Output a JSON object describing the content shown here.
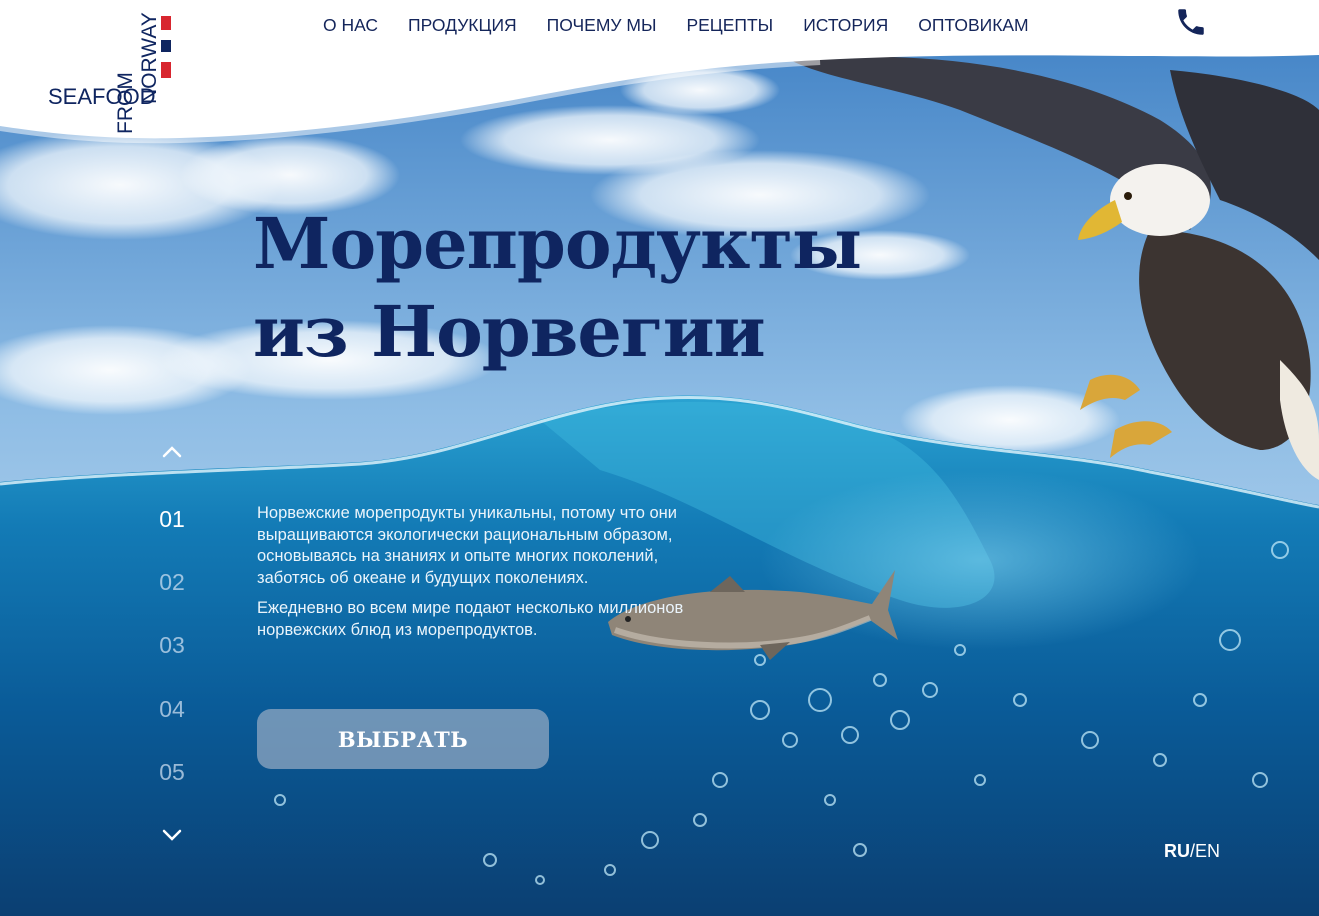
{
  "logo": {
    "seafood": "SEAFOOD",
    "from": "FROM",
    "norway": "NORWAY"
  },
  "nav": {
    "items": [
      "О НАС",
      "ПРОДУКЦИЯ",
      "ПОЧЕМУ МЫ",
      "РЕЦЕПТЫ",
      "ИСТОРИЯ",
      "ОПТОВИКАМ"
    ]
  },
  "header": {
    "phone_icon": "phone-icon"
  },
  "hero": {
    "title_line1": "Морепродукты",
    "title_line2": "из Норвегии",
    "paragraph1": "Норвежские морепродукты уникальны, потому что они выращиваются экологически рациональным образом, основываясь на знаниях и опыте многих поколений, заботясь об океане и будущих поколениях.",
    "paragraph2": "Ежедневно во всем мире подают несколько миллионов норвежских блюд из морепродуктов.",
    "button_label": "ВЫБРАТЬ"
  },
  "pager": {
    "up_icon": "chevron-up-icon",
    "down_icon": "chevron-down-icon",
    "numbers": [
      "01",
      "02",
      "03",
      "04",
      "05"
    ],
    "active_index": 0
  },
  "language": {
    "ru": "RU",
    "separator": "/",
    "en": "EN"
  },
  "colors": {
    "brand_navy": "#0f2560",
    "nav_text": "#14255a",
    "accent_red": "#d8262f",
    "button_bg": "#96aac3"
  }
}
